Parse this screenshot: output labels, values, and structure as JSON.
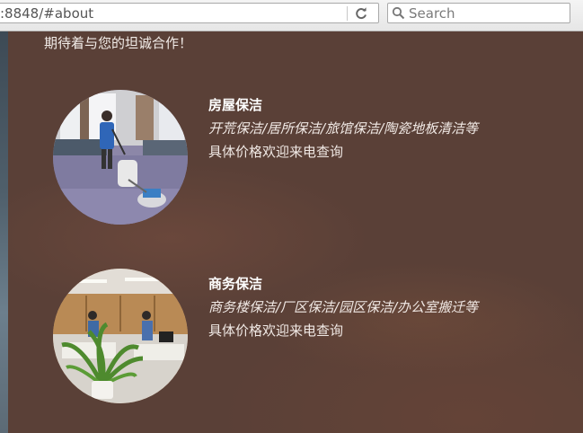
{
  "browser": {
    "url": ":8848/#about",
    "search_placeholder": "Search"
  },
  "page": {
    "intro": "期待着与您的坦诚合作！",
    "services": [
      {
        "title": "房屋保洁",
        "items": "开荒保洁/居所保洁/旅馆保洁/陶瓷地板清洁等",
        "price": "具体价格欢迎来电查询"
      },
      {
        "title": "商务保洁",
        "items": "商务楼保洁/厂区保洁/园区保洁/办公室搬迁等",
        "price": "具体价格欢迎来电查询"
      }
    ]
  }
}
